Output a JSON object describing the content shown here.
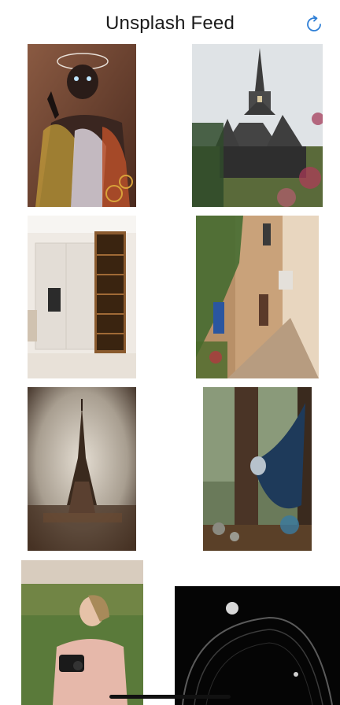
{
  "header": {
    "title": "Unsplash  Feed",
    "refresh_icon": "refresh-icon"
  },
  "colors": {
    "accent": "#2f7fd6",
    "background": "#ffffff",
    "text": "#1a1a1a"
  },
  "feed": {
    "items": [
      {
        "name": "photo-robot-figure",
        "subject": "robot-figure"
      },
      {
        "name": "photo-stave-church",
        "subject": "stave-church"
      },
      {
        "name": "photo-kitchen-interior",
        "subject": "kitchen-interior"
      },
      {
        "name": "photo-alley-street",
        "subject": "alley-street"
      },
      {
        "name": "photo-eiffel-tower",
        "subject": "eiffel-tower"
      },
      {
        "name": "photo-hammock-forest",
        "subject": "hammock-forest"
      },
      {
        "name": "photo-woman-camera",
        "subject": "woman-with-camera"
      },
      {
        "name": "photo-dark-abstract",
        "subject": "dark-abstract"
      }
    ]
  }
}
